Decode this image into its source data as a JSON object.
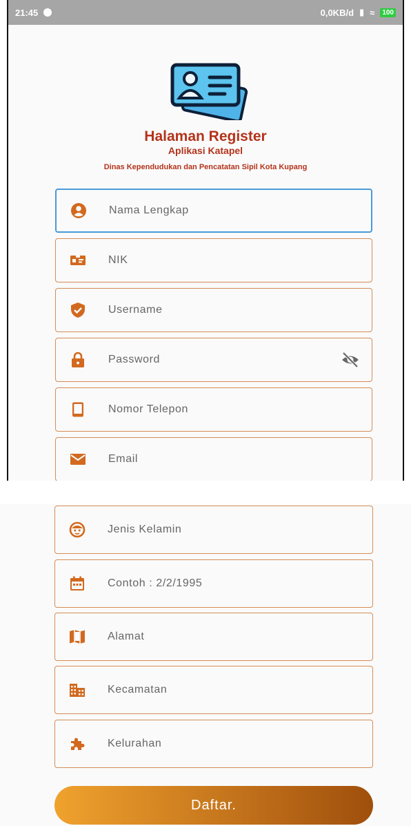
{
  "status_bar": {
    "time": "21:45",
    "network_speed": "0,0KB/d",
    "battery": "100"
  },
  "header": {
    "title": "Halaman Register",
    "app_name": "Aplikasi Katapel",
    "agency": "Dinas Kependudukan dan Pencatatan Sipil Kota Kupang"
  },
  "form": {
    "full_name_placeholder": "Nama Lengkap",
    "nik_placeholder": "NIK",
    "username_placeholder": "Username",
    "password_placeholder": "Password",
    "phone_placeholder": "Nomor Telepon",
    "email_placeholder": "Email",
    "gender_placeholder": "Jenis Kelamin",
    "birthdate_placeholder": "Contoh : 2/2/1995",
    "address_placeholder": "Alamat",
    "district_placeholder": "Kecamatan",
    "village_placeholder": "Kelurahan"
  },
  "submit_label": "Daftar.",
  "colors": {
    "accent": "#d2691e",
    "title": "#b3331b",
    "focus": "#4a9ad8"
  }
}
